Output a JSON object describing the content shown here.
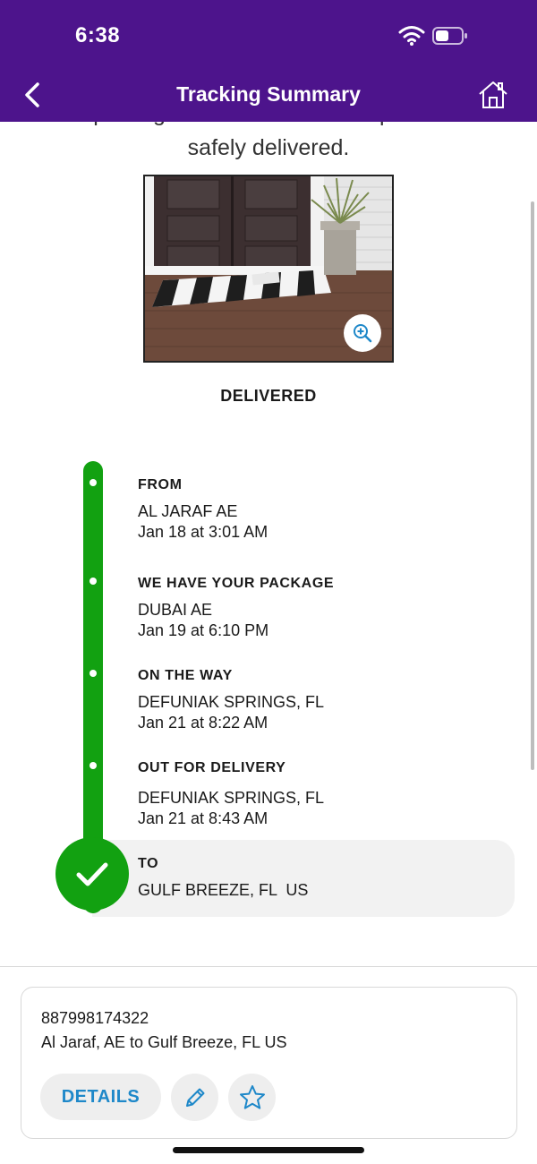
{
  "status_bar": {
    "time": "6:38"
  },
  "nav": {
    "title": "Tracking Summary",
    "back_icon": "chevron-left-icon",
    "home_icon": "home-icon"
  },
  "message": {
    "line1": "Your package was released as requested and",
    "line2": "safely delivered."
  },
  "photo": {
    "alt": "delivery photo",
    "zoom_icon": "zoom-in-icon"
  },
  "delivery_status": "DELIVERED",
  "timeline": [
    {
      "heading": "FROM",
      "location": "AL JARAF AE",
      "time": "Jan 18 at 3:01 AM"
    },
    {
      "heading": "WE HAVE YOUR PACKAGE",
      "location": "DUBAI AE",
      "time": "Jan 19 at 6:10 PM"
    },
    {
      "heading": "ON THE WAY",
      "location": "DEFUNIAK SPRINGS, FL",
      "time": "Jan 21 at 8:22 AM"
    },
    {
      "heading": "OUT FOR DELIVERY",
      "location": "DEFUNIAK SPRINGS, FL",
      "time": "Jan 21 at 8:43 AM"
    }
  ],
  "destination": {
    "heading": "TO",
    "location": "GULF BREEZE, FL  US"
  },
  "card": {
    "tracking_number": "887998174322",
    "route": "Al Jaraf, AE to Gulf Breeze, FL US",
    "details_label": "DETAILS",
    "edit_icon": "pencil-icon",
    "star_icon": "star-icon"
  },
  "colors": {
    "brand_purple": "#4d148c",
    "progress_green": "#12a111",
    "link_blue": "#1e88c9"
  }
}
